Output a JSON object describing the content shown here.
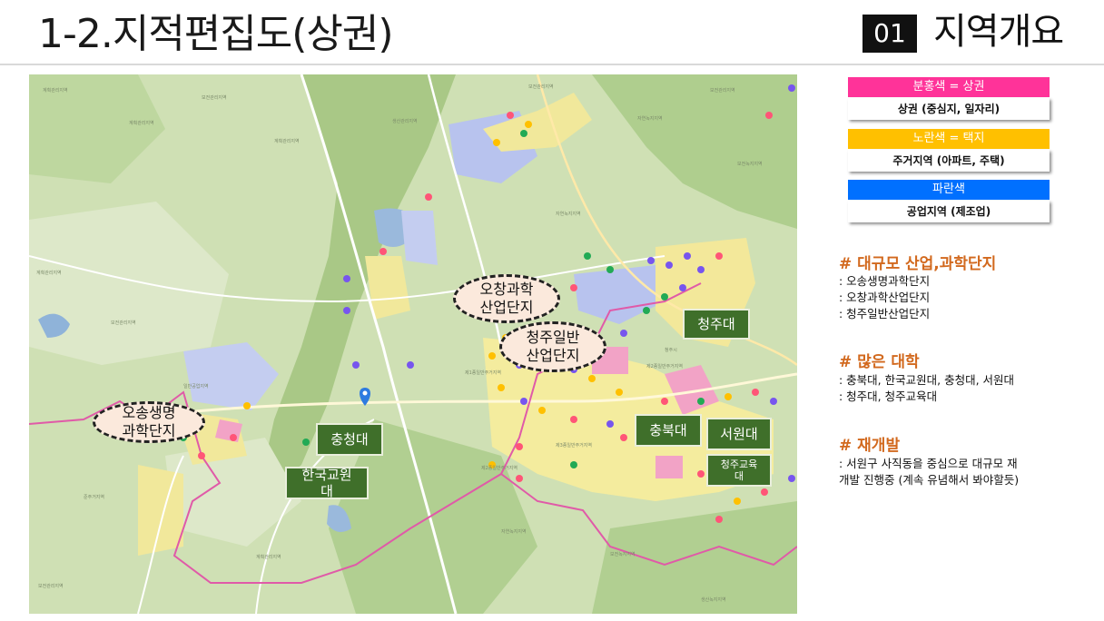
{
  "header": {
    "title": "1-2.지적편집도(상권)",
    "section_number": "01",
    "section_title": "지역개요"
  },
  "legend": [
    {
      "head": "분홍색 = 상권",
      "body": "상권 (중심지, 일자리)",
      "color": "#ff3399"
    },
    {
      "head": "노란색 = 택지",
      "body": "주거지역 (아파트, 주택)",
      "color": "#ffc000"
    },
    {
      "head": "파란색",
      "body": "공업지역 (제조업)",
      "color": "#0070ff"
    }
  ],
  "notes": [
    {
      "title": "# 대규모 산업,과학단지",
      "lines": [
        ": 오송생명과학단지",
        ": 오창과학산업단지",
        ": 청주일반산업단지"
      ]
    },
    {
      "title": "# 많은 대학",
      "lines": [
        ": 충북대, 한국교원대, 충청대, 서원대",
        ": 청주대, 청주교육대"
      ]
    },
    {
      "title": "# 재개발",
      "lines": [
        ": 서원구 사직동을 중심으로 대규모 재",
        "개발 진행중 (계속 유념해서 봐야할듯)"
      ]
    }
  ],
  "map": {
    "callouts": [
      "오창과학\n산업단지",
      "청주일반\n산업단지",
      "오송생명\n과학단지"
    ],
    "universities": [
      "청주대",
      "충청대",
      "한국교원\n대",
      "충북대",
      "서원대",
      "청주교육\n대"
    ],
    "area_labels": [
      "계획관리지역",
      "보전관리지역",
      "생산관리지역",
      "자연녹지지역",
      "생산녹지지역",
      "보전녹지지역",
      "일반공업지역",
      "제1종일반주거지역",
      "제2종일반주거지역",
      "제3종일반주거지역",
      "준주거지역",
      "청주시",
      "충북대",
      "흥덕구",
      "청원구",
      "자연녹지",
      "일반상업지역",
      "제1종전용주거지역"
    ]
  }
}
